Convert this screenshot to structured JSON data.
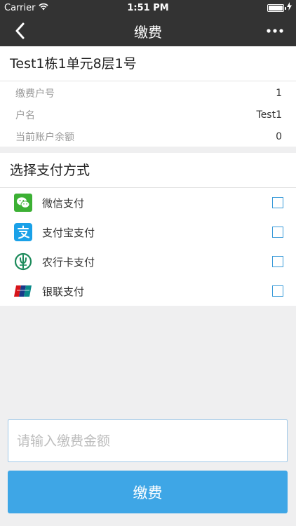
{
  "status_bar": {
    "carrier": "Carrier",
    "time": "1:51 PM",
    "battery": 1.0
  },
  "nav": {
    "title": "缴费",
    "back_icon": "chevron-left-icon",
    "more_icon": "more-horizontal-icon"
  },
  "info": {
    "title": "Test1栋1单元8层1号",
    "rows": [
      {
        "label": "缴费户号",
        "value": "1"
      },
      {
        "label": "户名",
        "value": "Test1"
      },
      {
        "label": "当前账户余额",
        "value": "0"
      }
    ]
  },
  "payment": {
    "title": "选择支付方式",
    "methods": [
      {
        "label": "微信支付",
        "icon": "wechat-pay-icon",
        "color": "#3cb034",
        "checked": false
      },
      {
        "label": "支付宝支付",
        "icon": "alipay-icon",
        "color": "#1aa1e8",
        "checked": false
      },
      {
        "label": "农行卡支付",
        "icon": "abc-bank-icon",
        "color": "#1b8a5a",
        "checked": false
      },
      {
        "label": "银联支付",
        "icon": "unionpay-icon",
        "color": "#d7141a",
        "checked": false
      }
    ]
  },
  "amount": {
    "placeholder": "请输入缴费金额",
    "value": ""
  },
  "submit": {
    "label": "缴费",
    "color": "#3ea6e6"
  }
}
